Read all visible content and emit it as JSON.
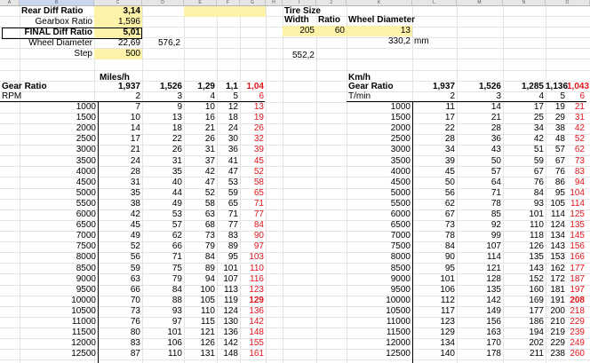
{
  "column_headers": [
    "A",
    "B",
    "C",
    "D",
    "E",
    "F",
    "G",
    "H",
    "I",
    "J",
    "K",
    "L",
    "M",
    "N",
    "O"
  ],
  "top": {
    "rear_diff_label": "Rear Diff Ratio",
    "rear_diff_value": "3,14",
    "gearbox_label": "Gearbox Ratio",
    "gearbox_value": "1,596",
    "final_label": "FINAL Diff Ratio",
    "final_value": "5,01",
    "wheel_label": "Wheel Diameter",
    "wheel_value": "22,69",
    "wheel_calc": "576,2",
    "step_label": "Step",
    "step_value": "500",
    "tire_title": "Tire Size",
    "width_label": "Width",
    "ratio_label": "Ratio",
    "wheel_diam_label": "Wheel Diameter",
    "width_value": "205",
    "ratio_value": "60",
    "wheel_diam_value": "13",
    "mm_value": "330,2",
    "mm_unit": "mm",
    "tire_calc": "552,2"
  },
  "miles": {
    "title": "Miles/h",
    "gear_label": "Gear Ratio",
    "rpm_label": "RPM",
    "ratios": [
      "1,937",
      "1,526",
      "1,29",
      "1,1",
      "1,04"
    ],
    "gears": [
      "2",
      "3",
      "4",
      "5",
      "6"
    ],
    "rows": [
      [
        "1000",
        "7",
        "9",
        "10",
        "12",
        "13"
      ],
      [
        "1500",
        "10",
        "13",
        "16",
        "18",
        "19"
      ],
      [
        "2000",
        "14",
        "18",
        "21",
        "24",
        "26"
      ],
      [
        "2500",
        "17",
        "22",
        "26",
        "30",
        "32"
      ],
      [
        "3000",
        "21",
        "26",
        "31",
        "36",
        "39"
      ],
      [
        "3500",
        "24",
        "31",
        "37",
        "41",
        "45"
      ],
      [
        "4000",
        "28",
        "35",
        "42",
        "47",
        "52"
      ],
      [
        "4500",
        "31",
        "40",
        "47",
        "53",
        "58"
      ],
      [
        "5000",
        "35",
        "44",
        "52",
        "59",
        "65"
      ],
      [
        "5500",
        "38",
        "49",
        "58",
        "65",
        "71"
      ],
      [
        "6000",
        "42",
        "53",
        "63",
        "71",
        "77"
      ],
      [
        "6500",
        "45",
        "57",
        "68",
        "77",
        "84"
      ],
      [
        "7000",
        "49",
        "62",
        "73",
        "83",
        "90"
      ],
      [
        "7500",
        "52",
        "66",
        "79",
        "89",
        "97"
      ],
      [
        "8000",
        "56",
        "71",
        "84",
        "95",
        "103"
      ],
      [
        "8500",
        "59",
        "75",
        "89",
        "101",
        "110"
      ],
      [
        "9000",
        "63",
        "79",
        "94",
        "107",
        "116"
      ],
      [
        "9500",
        "66",
        "84",
        "100",
        "113",
        "123"
      ],
      [
        "10000",
        "70",
        "88",
        "105",
        "119",
        "129"
      ],
      [
        "10500",
        "73",
        "93",
        "110",
        "124",
        "136"
      ],
      [
        "11000",
        "76",
        "97",
        "115",
        "130",
        "142"
      ],
      [
        "11500",
        "80",
        "101",
        "121",
        "136",
        "148"
      ],
      [
        "12000",
        "83",
        "106",
        "126",
        "142",
        "155"
      ],
      [
        "12500",
        "87",
        "110",
        "131",
        "148",
        "161"
      ]
    ]
  },
  "kmh": {
    "title": "Km/h",
    "gear_label": "Gear Ratio",
    "rpm_label": "T/min",
    "ratios": [
      "1,937",
      "1,526",
      "1,285",
      "1,136",
      "1,043"
    ],
    "gears": [
      "2",
      "3",
      "4",
      "5",
      "6"
    ],
    "rows": [
      [
        "1000",
        "11",
        "14",
        "17",
        "19",
        "21"
      ],
      [
        "1500",
        "17",
        "21",
        "25",
        "29",
        "31"
      ],
      [
        "2000",
        "22",
        "28",
        "34",
        "38",
        "42"
      ],
      [
        "2500",
        "28",
        "36",
        "42",
        "48",
        "52"
      ],
      [
        "3000",
        "34",
        "43",
        "51",
        "57",
        "62"
      ],
      [
        "3500",
        "39",
        "50",
        "59",
        "67",
        "73"
      ],
      [
        "4000",
        "45",
        "57",
        "67",
        "76",
        "83"
      ],
      [
        "4500",
        "50",
        "64",
        "76",
        "86",
        "94"
      ],
      [
        "5000",
        "56",
        "71",
        "84",
        "95",
        "104"
      ],
      [
        "5500",
        "62",
        "78",
        "93",
        "105",
        "114"
      ],
      [
        "6000",
        "67",
        "85",
        "101",
        "114",
        "125"
      ],
      [
        "6500",
        "73",
        "92",
        "110",
        "124",
        "135"
      ],
      [
        "7000",
        "78",
        "99",
        "118",
        "134",
        "145"
      ],
      [
        "7500",
        "84",
        "107",
        "126",
        "143",
        "156"
      ],
      [
        "8000",
        "90",
        "114",
        "135",
        "153",
        "166"
      ],
      [
        "8500",
        "95",
        "121",
        "143",
        "162",
        "177"
      ],
      [
        "9000",
        "101",
        "128",
        "152",
        "172",
        "187"
      ],
      [
        "9500",
        "106",
        "135",
        "160",
        "181",
        "197"
      ],
      [
        "10000",
        "112",
        "142",
        "169",
        "191",
        "208"
      ],
      [
        "10500",
        "117",
        "149",
        "177",
        "200",
        "218"
      ],
      [
        "11000",
        "123",
        "156",
        "186",
        "210",
        "229"
      ],
      [
        "11500",
        "129",
        "163",
        "194",
        "219",
        "239"
      ],
      [
        "12000",
        "134",
        "170",
        "202",
        "229",
        "249"
      ],
      [
        "12500",
        "140",
        "178",
        "211",
        "238",
        "260"
      ]
    ]
  }
}
